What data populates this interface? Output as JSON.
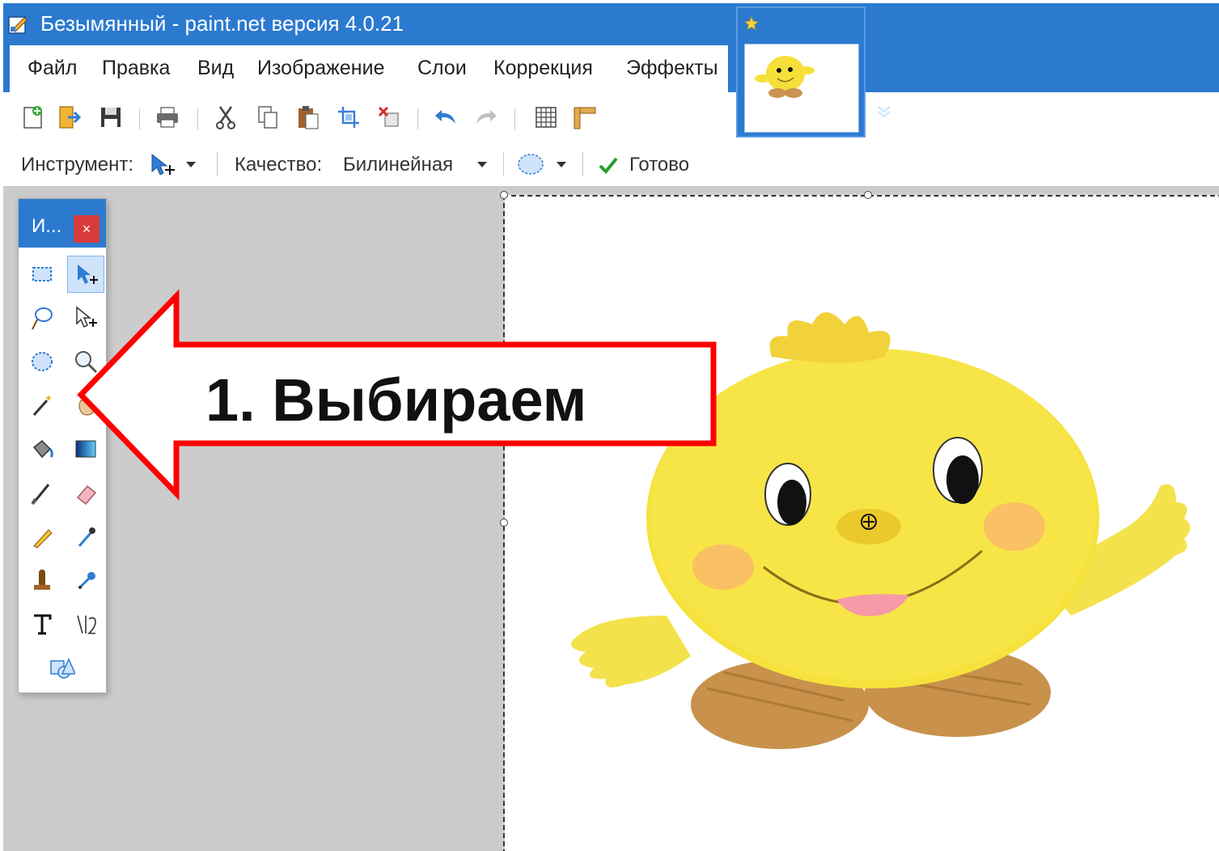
{
  "window": {
    "title": "Безымянный - paint.net версия 4.0.21"
  },
  "menu": {
    "items": [
      "Файл",
      "Правка",
      "Вид",
      "Изображение",
      "Слои",
      "Коррекция",
      "Эффекты"
    ]
  },
  "toolbar": {
    "buttons": [
      "new-file",
      "open-file",
      "save",
      "print",
      "cut",
      "copy",
      "paste",
      "crop",
      "delete-selection",
      "undo",
      "redo",
      "grid",
      "ruler"
    ]
  },
  "options": {
    "tool_label": "Инструмент:",
    "quality_label": "Качество:",
    "quality_value": "Билинейная",
    "done_label": "Готово"
  },
  "tools_window": {
    "title": "И...",
    "close": "×",
    "tools": [
      "rectangle-select",
      "move-selected-pixels",
      "lasso-select",
      "move-selection",
      "ellipse-select",
      "zoom",
      "magic-wand",
      "pan",
      "paint-bucket",
      "gradient",
      "paintbrush",
      "eraser",
      "pencil",
      "color-picker",
      "clone-stamp",
      "recolor",
      "text",
      "line-curve",
      "shapes"
    ],
    "active_tool": "move-selected-pixels"
  },
  "annotation": {
    "text": "1. Выбираем",
    "color": "#ff0000"
  },
  "colors": {
    "accent": "#2b7ad0",
    "workspace": "#cccccc",
    "close": "#d83b3b"
  }
}
